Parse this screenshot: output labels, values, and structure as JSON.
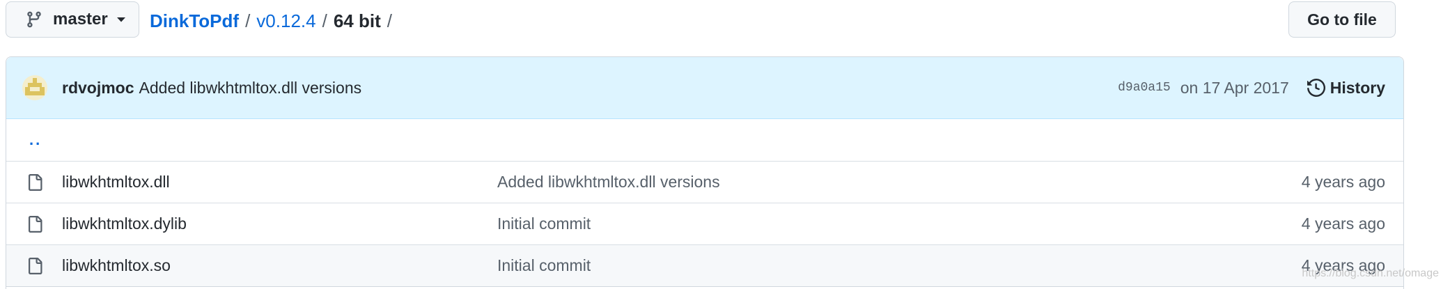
{
  "branch": {
    "name": "master"
  },
  "breadcrumb": {
    "repo": "DinkToPdf",
    "sep1": "/",
    "version": "v0.12.4",
    "sep2": "/",
    "current": "64 bit",
    "sep3": "/"
  },
  "goto_file": {
    "label": "Go to file"
  },
  "latest_commit": {
    "author": "rdvojmoc",
    "message": "Added libwkhtmltox.dll versions",
    "sha": "d9a0a15",
    "date": "on 17 Apr 2017",
    "history_label": "History"
  },
  "parent_dir": {
    "label": ".."
  },
  "files": [
    {
      "name": "libwkhtmltox.dll",
      "commit": "Added libwkhtmltox.dll versions",
      "age": "4 years ago",
      "icon": "file-icon"
    },
    {
      "name": "libwkhtmltox.dylib",
      "commit": "Initial commit",
      "age": "4 years ago",
      "icon": "file-icon"
    },
    {
      "name": "libwkhtmltox.so",
      "commit": "Initial commit",
      "age": "4 years ago",
      "icon": "file-icon"
    }
  ],
  "watermark": "https://blog.csdn.net/omage",
  "colors": {
    "link": "#0969da",
    "commit_header_bg": "#ddf4ff",
    "border": "#d0d7de",
    "muted_text": "#57606a"
  }
}
